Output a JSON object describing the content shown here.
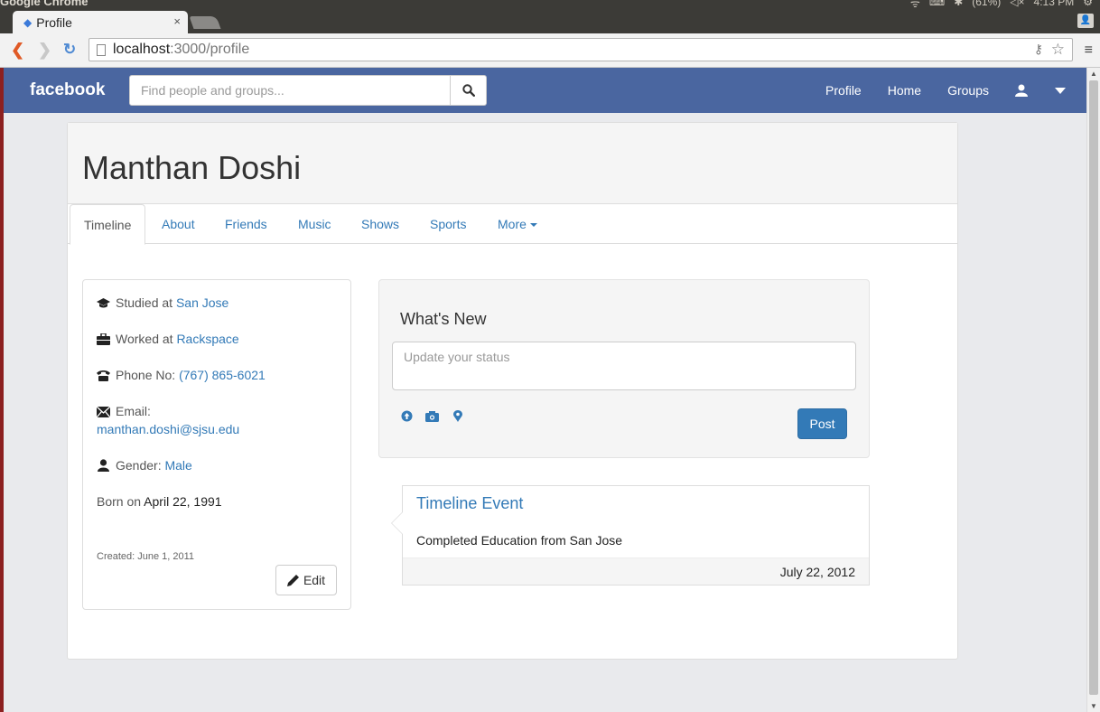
{
  "os": {
    "app_title": "Google Chrome",
    "status": [
      "(61%)",
      "4:13 PM"
    ]
  },
  "browser": {
    "tab_title": "Profile",
    "url_host": "localhost",
    "url_path": ":3000/profile"
  },
  "navbar": {
    "brand": "facebook",
    "search_placeholder": "Find people and groups...",
    "links": [
      "Profile",
      "Home",
      "Groups"
    ]
  },
  "profile": {
    "name": "Manthan Doshi",
    "tabs": [
      "Timeline",
      "About",
      "Friends",
      "Music",
      "Shows",
      "Sports",
      "More"
    ],
    "info": {
      "studied_label": "Studied at",
      "studied_value": "San Jose",
      "worked_label": "Worked at",
      "worked_value": "Rackspace",
      "phone_label": "Phone No:",
      "phone_value": "(767) 865-6021",
      "email_label": "Email:",
      "email_value": "manthan.doshi@sjsu.edu",
      "gender_label": "Gender:",
      "gender_value": "Male",
      "born_label": "Born on",
      "born_value": "April 22, 1991",
      "created": "Created: June 1, 2011",
      "edit_label": "Edit"
    },
    "whats_new": {
      "title": "What's New",
      "placeholder": "Update your status",
      "post_label": "Post"
    },
    "timeline_event": {
      "title": "Timeline Event",
      "body": "Completed Education from San Jose",
      "date": "July 22, 2012"
    }
  },
  "colors": {
    "navbar": "#4a66a0",
    "link": "#337ab7",
    "primary_button": "#337ab7"
  }
}
